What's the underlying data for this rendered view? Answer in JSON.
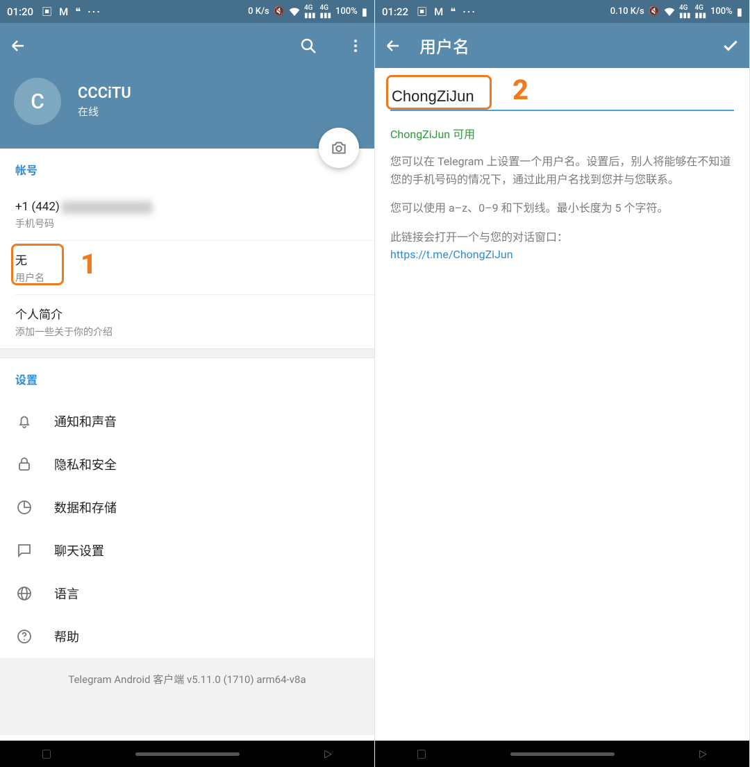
{
  "left": {
    "status": {
      "time": "01:20",
      "net": "0 K/s",
      "battery": "100%"
    },
    "profile": {
      "avatarLetter": "C",
      "name": "CCCiTU",
      "status": "在线"
    },
    "account": {
      "title": "帐号",
      "phonePrefix": "+1 (442) ",
      "phoneLabel": "手机号码",
      "usernameValue": "无",
      "usernameLabel": "用户名",
      "bioValue": "个人简介",
      "bioHint": "添加一些关于你的介绍"
    },
    "settings": {
      "title": "设置",
      "items": [
        {
          "label": "通知和声音",
          "icon": "bell-icon"
        },
        {
          "label": "隐私和安全",
          "icon": "lock-icon"
        },
        {
          "label": "数据和存储",
          "icon": "data-icon"
        },
        {
          "label": "聊天设置",
          "icon": "chat-icon"
        },
        {
          "label": "语言",
          "icon": "globe-icon"
        },
        {
          "label": "帮助",
          "icon": "help-icon"
        }
      ]
    },
    "footer": "Telegram Android 客户端 v5.11.0 (1710) arm64-v8a",
    "annotation": "1"
  },
  "right": {
    "status": {
      "time": "01:22",
      "net": "0.10 K/s",
      "battery": "100%"
    },
    "title": "用户名",
    "input": "ChongZiJun",
    "avail": "ChongZiJun 可用",
    "help1": "您可以在 Telegram 上设置一个用户名。设置后，别人将能够在不知道您的手机号码的情况下，通过此用户名找到您并与您联系。",
    "help2": "您可以使用 a–z、0–9 和下划线。最小长度为 5 个字符。",
    "help3": "此链接会打开一个与您的对话窗口：",
    "link": "https://t.me/ChongZiJun",
    "annotation": "2"
  }
}
